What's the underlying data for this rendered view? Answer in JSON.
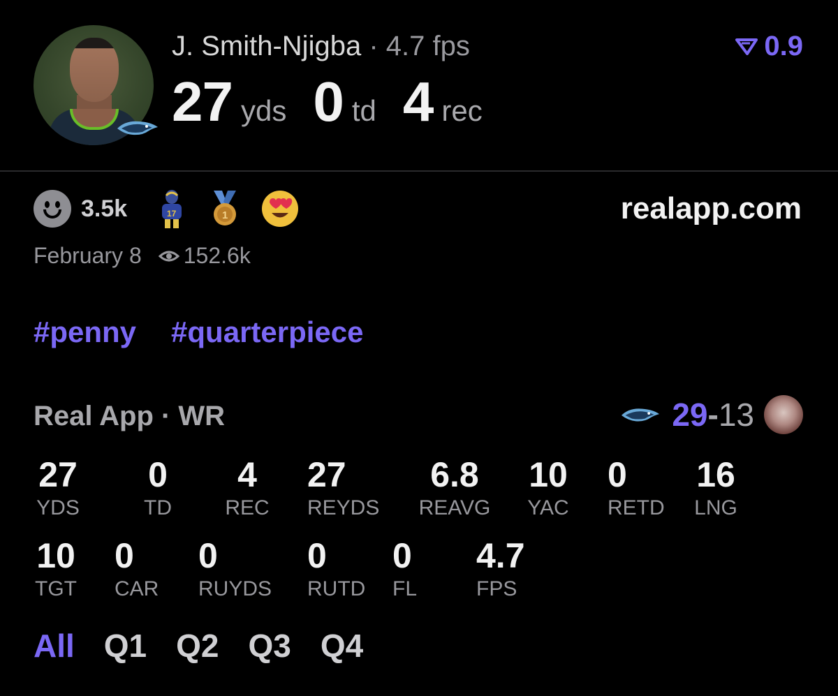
{
  "header": {
    "player_name": "J. Smith-Njigba",
    "separator": "·",
    "fps_text": "4.7 fps",
    "stats": [
      {
        "value": "27",
        "unit": "yds"
      },
      {
        "value": "0",
        "unit": "td"
      },
      {
        "value": "4",
        "unit": "rec"
      }
    ],
    "score_badge": "0.9"
  },
  "reactions": {
    "count": "3.5k",
    "icons": [
      "player-sticker-icon",
      "medal-icon",
      "heart-eyes-icon"
    ]
  },
  "domain": "realapp.com",
  "meta": {
    "date": "February 8",
    "views": "152.6k"
  },
  "tags": [
    "#penny",
    "#quarterpiece"
  ],
  "game": {
    "title": "Real App · WR",
    "score_home": "29",
    "score_dash": "-",
    "score_away": "13"
  },
  "stats_rows": [
    [
      {
        "value": "27",
        "label": "YDS"
      },
      {
        "value": "0",
        "label": "TD"
      },
      {
        "value": "4",
        "label": "REC"
      },
      {
        "value": "27",
        "label": "REYDS"
      },
      {
        "value": "6.8",
        "label": "REAVG"
      },
      {
        "value": "10",
        "label": "YAC"
      },
      {
        "value": "0",
        "label": "RETD"
      },
      {
        "value": "16",
        "label": "LNG"
      }
    ],
    [
      {
        "value": "10",
        "label": "TGT"
      },
      {
        "value": "0",
        "label": "CAR"
      },
      {
        "value": "0",
        "label": "RUYDS"
      },
      {
        "value": "0",
        "label": "RUTD"
      },
      {
        "value": "0",
        "label": "FL"
      },
      {
        "value": "4.7",
        "label": "FPS"
      }
    ]
  ],
  "quarters": [
    "All",
    "Q1",
    "Q2",
    "Q3",
    "Q4"
  ],
  "colors": {
    "accent": "#7b68f5",
    "background": "#000000",
    "muted": "#98989d"
  }
}
